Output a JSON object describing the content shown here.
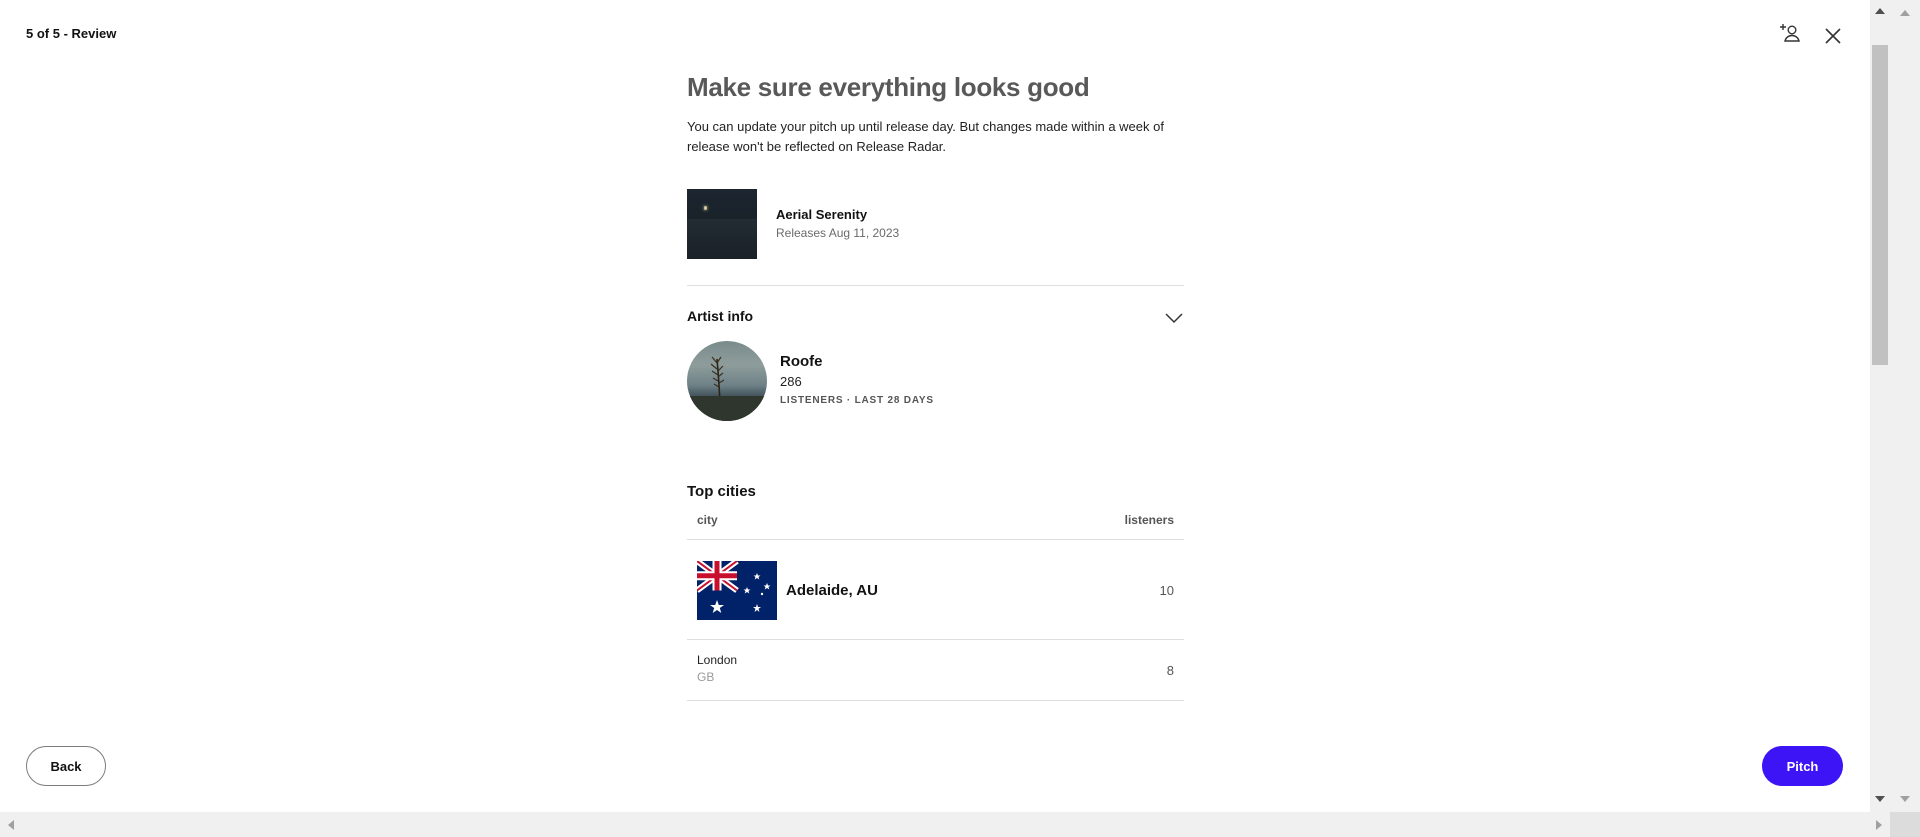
{
  "header": {
    "step_label": "5 of 5 - Review",
    "invite_icon": "add-person-icon",
    "close_icon": "close-icon"
  },
  "main": {
    "title": "Make sure everything looks good",
    "subtitle": "You can update your pitch up until release day. But changes made within a week of release won't be reflected on Release Radar."
  },
  "release": {
    "name": "Aerial Serenity",
    "date": "Releases Aug 11, 2023"
  },
  "artist_info": {
    "section_label": "Artist info",
    "name": "Roofe",
    "listeners": "286",
    "caption": "LISTENERS · LAST 28 DAYS"
  },
  "top_cities": {
    "title": "Top cities",
    "col_city": "city",
    "col_listeners": "listeners",
    "rows": [
      {
        "city": "Adelaide, AU",
        "country": "",
        "listeners": "10",
        "flag": "australia-flag"
      },
      {
        "city": "London",
        "country": "GB",
        "listeners": "8",
        "flag": ""
      }
    ]
  },
  "footer": {
    "back_label": "Back",
    "pitch_label": "Pitch"
  },
  "colors": {
    "accent": "#3d14f5",
    "title_gray": "#595959",
    "divider": "#dedede"
  }
}
